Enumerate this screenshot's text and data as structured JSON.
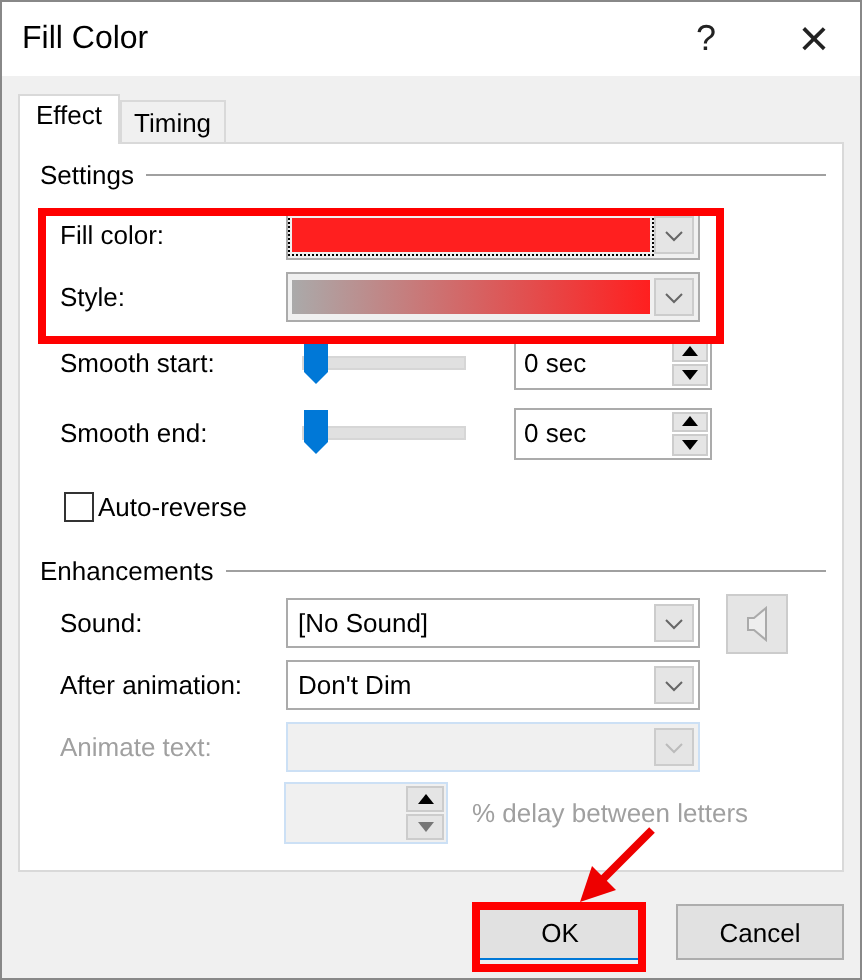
{
  "window": {
    "title": "Fill Color",
    "help": "?",
    "close": "×"
  },
  "tabs": [
    {
      "label": "Effect",
      "selected": true
    },
    {
      "label": "Timing",
      "selected": false
    }
  ],
  "settings": {
    "heading": "Settings",
    "fill_color": {
      "label": "Fill color:",
      "color": "#ff1f1f"
    },
    "style": {
      "label": "Style:"
    },
    "sliders": [
      {
        "label": "Smooth start:",
        "level": 0,
        "value": "0 sec"
      },
      {
        "label": "Smooth end:",
        "level": 0,
        "value": "0 sec"
      }
    ],
    "auto_reverse": {
      "label": "Auto-reverse",
      "checked": false
    }
  },
  "enhancements": {
    "heading": "Enhancements",
    "sound": {
      "label": "Sound:",
      "value": "[No Sound]"
    },
    "after_animation": {
      "label": "After animation:",
      "value": "Don't Dim"
    },
    "animate_text": {
      "label": "Animate text:",
      "disabled": true
    },
    "delay": {
      "label": "% delay between letters",
      "disabled": true
    }
  },
  "buttons": [
    {
      "label": "OK",
      "kind": "default"
    },
    {
      "label": "Cancel",
      "kind": "normal"
    }
  ]
}
